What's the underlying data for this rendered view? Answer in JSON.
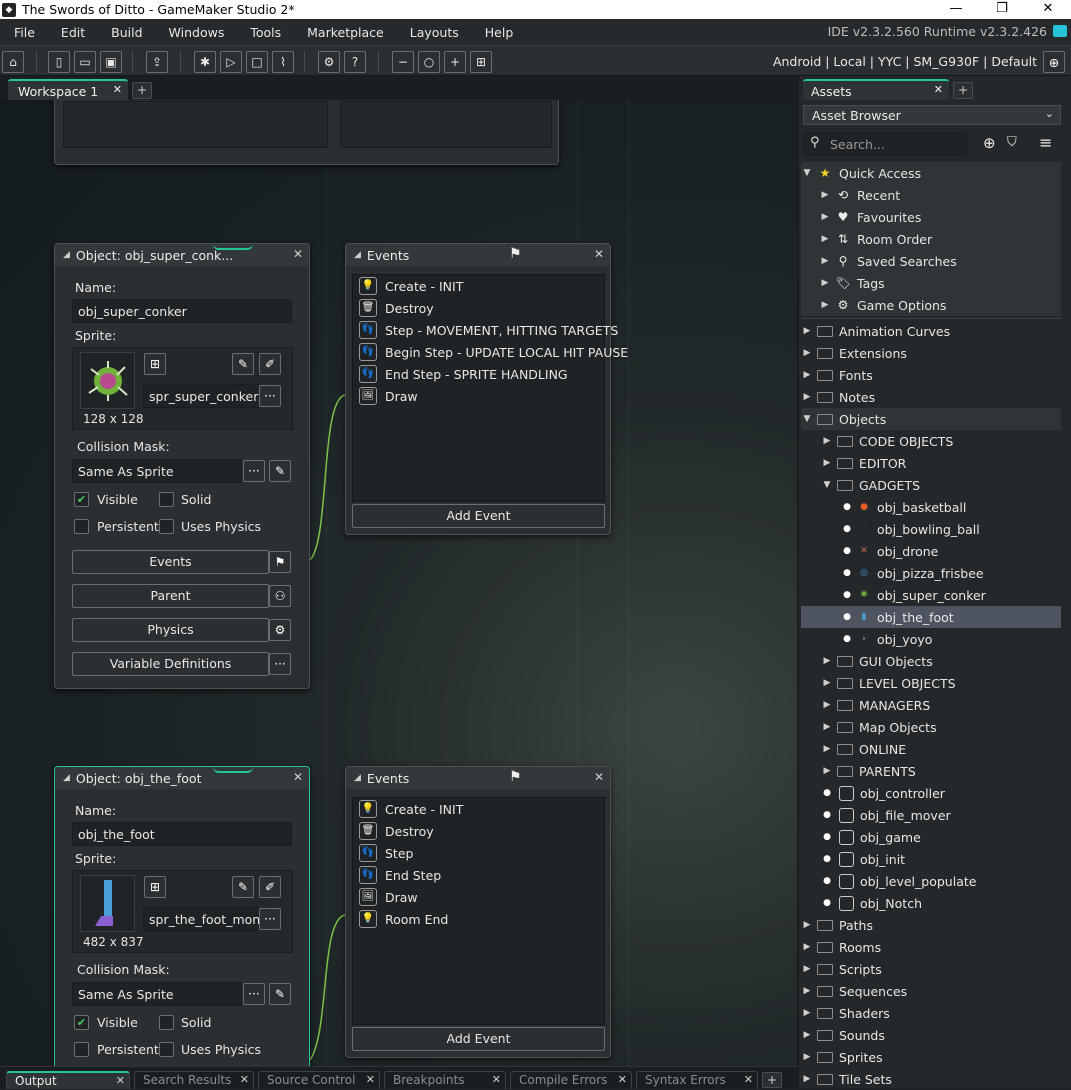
{
  "window": {
    "title": "The Swords of Ditto - GameMaker Studio 2*",
    "minimize": "—",
    "restore": "❐",
    "close": "✕"
  },
  "menu": {
    "items": [
      "File",
      "Edit",
      "Build",
      "Windows",
      "Tools",
      "Marketplace",
      "Layouts",
      "Help"
    ],
    "version": "IDE v2.3.2.560  Runtime v2.3.2.426"
  },
  "toolbar": {
    "target": "Android | Local | YYC | SM_G930F | Default"
  },
  "workspace": {
    "tab": "Workspace 1",
    "close": "✕",
    "add": "+"
  },
  "panels": {
    "conker": {
      "title": "Object: obj_super_conk...",
      "name_label": "Name:",
      "name_value": "obj_super_conker",
      "sprite_label": "Sprite:",
      "sprite_value": "spr_super_conker",
      "sprite_size": "128 x 128",
      "mask_label": "Collision Mask:",
      "mask_value": "Same As Sprite",
      "visible": "Visible",
      "solid": "Solid",
      "persistent": "Persistent",
      "physics_chk": "Uses Physics",
      "events_btn": "Events",
      "parent_btn": "Parent",
      "physics_btn": "Physics",
      "vardefs_btn": "Variable Definitions",
      "visible_checked": true,
      "solid_checked": false,
      "persistent_checked": false,
      "physics_checked": false
    },
    "conker_events": {
      "title": "Events",
      "items": [
        {
          "icon": "💡",
          "label": "Create - INIT"
        },
        {
          "icon": "🗑",
          "label": "Destroy"
        },
        {
          "icon": "👣",
          "label": "Step - MOVEMENT, HITTING TARGETS"
        },
        {
          "icon": "👣",
          "label": "Begin Step - UPDATE LOCAL HIT PAUSE"
        },
        {
          "icon": "👣",
          "label": "End Step - SPRITE HANDLING"
        },
        {
          "icon": "🖼",
          "label": "Draw"
        }
      ],
      "add": "Add Event"
    },
    "foot": {
      "title": "Object: obj_the_foot",
      "name_label": "Name:",
      "name_value": "obj_the_foot",
      "sprite_label": "Sprite:",
      "sprite_value": "spr_the_foot_mon...",
      "sprite_size": "482 x 837",
      "mask_label": "Collision Mask:",
      "mask_value": "Same As Sprite",
      "visible": "Visible",
      "solid": "Solid",
      "persistent": "Persistent",
      "physics_chk": "Uses Physics",
      "visible_checked": true,
      "solid_checked": false,
      "persistent_checked": false,
      "physics_checked": false
    },
    "foot_events": {
      "title": "Events",
      "items": [
        {
          "icon": "💡",
          "label": "Create - INIT"
        },
        {
          "icon": "🗑",
          "label": "Destroy"
        },
        {
          "icon": "👣",
          "label": "Step"
        },
        {
          "icon": "👣",
          "label": "End Step"
        },
        {
          "icon": "🖼",
          "label": "Draw"
        },
        {
          "icon": "💡",
          "label": "Room End"
        }
      ],
      "add": "Add Event"
    }
  },
  "assets": {
    "tab": "Assets",
    "close": "✕",
    "add": "+",
    "browser": "Asset Browser",
    "search_placeholder": "Search...",
    "quick_access": {
      "label": "Quick Access",
      "items": [
        "Recent",
        "Favourites",
        "Room Order",
        "Saved Searches",
        "Tags",
        "Game Options"
      ]
    },
    "tree": {
      "top": [
        "Animation Curves",
        "Extensions",
        "Fonts",
        "Notes"
      ],
      "objects": "Objects",
      "object_folders_before": [
        "CODE OBJECTS",
        "EDITOR"
      ],
      "gadgets": "GADGETS",
      "gadget_items": [
        "obj_basketball",
        "obj_bowling_ball",
        "obj_drone",
        "obj_pizza_frisbee",
        "obj_super_conker",
        "obj_the_foot",
        "obj_yoyo"
      ],
      "object_folders_after": [
        "GUI Objects",
        "LEVEL OBJECTS",
        "MANAGERS",
        "Map Objects",
        "ONLINE",
        "PARENTS"
      ],
      "object_items": [
        "obj_controller",
        "obj_file_mover",
        "obj_game",
        "obj_init",
        "obj_level_populate",
        "obj_Notch"
      ],
      "bottom": [
        "Paths",
        "Rooms",
        "Scripts",
        "Sequences",
        "Shaders",
        "Sounds",
        "Sprites",
        "Tile Sets"
      ]
    },
    "selected": "obj_the_foot"
  },
  "bottom_tabs": [
    "Output",
    "Search Results",
    "Source Control",
    "Breakpoints",
    "Compile Errors",
    "Syntax Errors"
  ],
  "colors": {
    "accent": "#26c49b",
    "selection": "#4e5560",
    "check": "#4ccc5a"
  }
}
